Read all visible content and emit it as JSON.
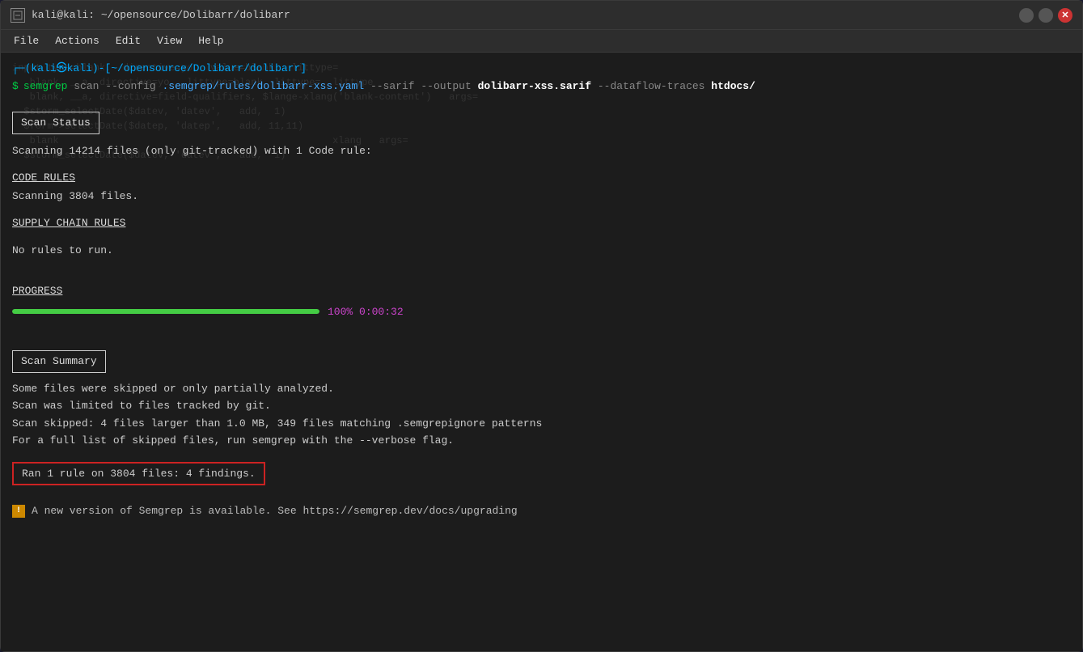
{
  "window": {
    "title": "kali@kali: ~/opensource/Dolibarr/dolibarr",
    "icon_label": "terminal-icon"
  },
  "controls": {
    "minimize_label": "",
    "maximize_label": "",
    "close_label": "✕"
  },
  "menu": {
    "items": [
      "File",
      "Actions",
      "Edit",
      "View",
      "Help"
    ]
  },
  "terminal": {
    "prompt_user": "(kali㉿kali)",
    "prompt_path": "-[~/opensource/Dolibarr/dolibarr]",
    "prompt_dollar": "$",
    "command": "semgrep scan --config .semgrep/rules/dolibarr-xss.yaml --sarif --output dolibarr-xss.sarif --dataflow-traces htdocs/",
    "ghost_lines": [
      "input_type=blank, directive=yo, value=blank, littype=",
      "   blank, __a, directive=yo, littype=blank, littype=  littype",
      "  $form->selectDate($datep, 'datep',   add, 11,11)",
      "   blank, __a, directive=field-qualifiers, $lange-xlang('blank-content')   args=",
      "  $storm_selectDate($datev, 'datev',   add,  1)",
      "  $storm_selectDate($datev, 'datev',   add,  1)",
      "   blank                                             xlang   args=                    xlang ="
    ],
    "scan_status_label": "Scan Status",
    "scan_status_line1": "Scanning 14214 files (only git-tracked) with 1 Code rule:",
    "code_rules_label": "CODE RULES",
    "code_rules_scanning": "Scanning 3804 files.",
    "supply_chain_label": "SUPPLY CHAIN RULES",
    "supply_chain_no_rules": "No rules to run.",
    "progress_label": "PROGRESS",
    "progress_percent": "100%",
    "progress_time": "0:00:32",
    "progress_value": 100,
    "scan_summary_label": "Scan Summary",
    "summary_line1": "Some files were skipped or only partially analyzed.",
    "summary_line2": "  Scan was limited to files tracked by git.",
    "summary_line3": "  Scan skipped: 4 files larger than 1.0 MB, 349 files matching .semgrepignore patterns",
    "summary_line4": "  For a full list of skipped files, run semgrep with the --verbose flag.",
    "findings_text": "Ran 1 rule on 3804 files: 4 findings.",
    "notice_text": "A new version of Semgrep is available. See https://semgrep.dev/docs/upgrading"
  }
}
